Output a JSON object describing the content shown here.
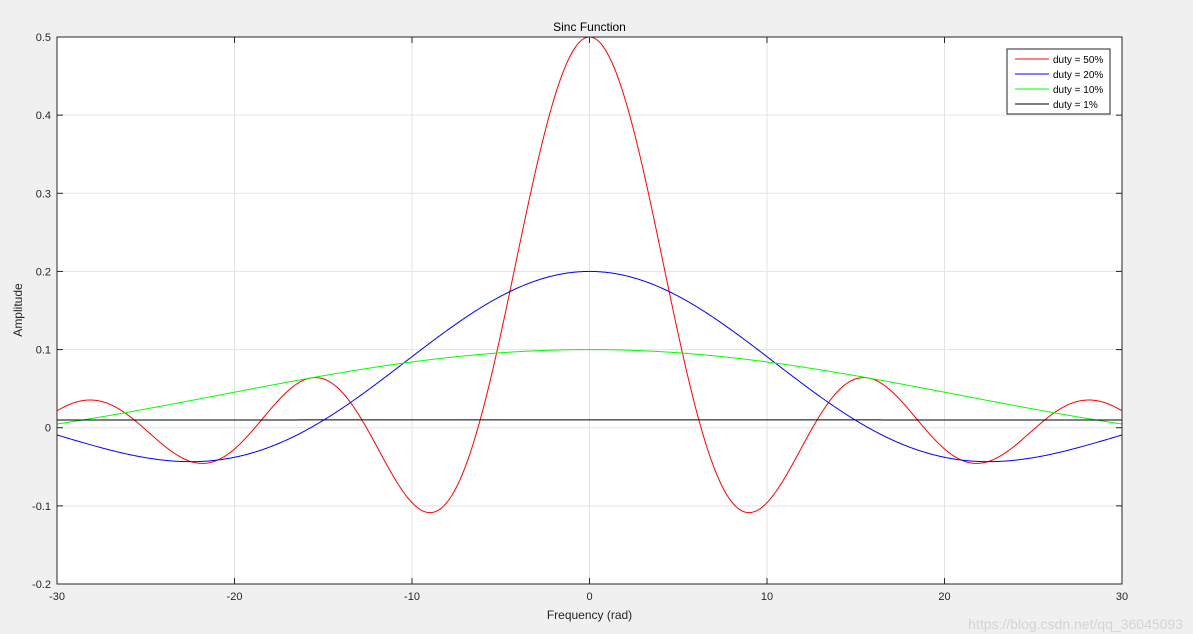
{
  "watermark": "https://blog.csdn.net/qq_36045093",
  "chart_data": {
    "type": "line",
    "title": "Sinc Function",
    "xlabel": "Frequency (rad)",
    "ylabel": "Amplitude",
    "xlim": [
      -30,
      30
    ],
    "ylim": [
      -0.2,
      0.5
    ],
    "xticks": [
      -30,
      -20,
      -10,
      0,
      10,
      20,
      30
    ],
    "xtick_labels": [
      "-30",
      "-20",
      "-10",
      "0",
      "10",
      "20",
      "30"
    ],
    "yticks": [
      -0.2,
      -0.1,
      0,
      0.1,
      0.2,
      0.3,
      0.4,
      0.5
    ],
    "ytick_labels": [
      "-0.2",
      "-0.1",
      "0",
      "0.1",
      "0.2",
      "0.3",
      "0.4",
      "0.5"
    ],
    "grid": true,
    "legend_position": "top-right",
    "series": [
      {
        "name": "duty = 50%",
        "duty": 0.5,
        "color": "#ff0000"
      },
      {
        "name": "duty = 20%",
        "duty": 0.2,
        "color": "#0000ff"
      },
      {
        "name": "duty = 10%",
        "duty": 0.1,
        "color": "#00ff00"
      },
      {
        "name": "duty = 1%",
        "duty": 0.01,
        "color": "#000000"
      }
    ],
    "function": "y = duty * sinc(duty * x / pi) = sin(duty * x) / x"
  }
}
